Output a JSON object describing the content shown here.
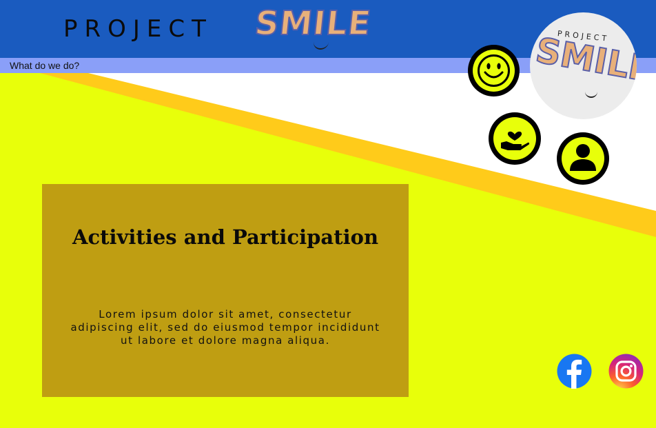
{
  "header": {
    "brand_word": "PROJECT",
    "logo_word": "SMILE"
  },
  "nav": {
    "link_label": "What do we do?"
  },
  "badge": {
    "small_text": "PROJECT",
    "logo_word": "SMILE"
  },
  "card": {
    "title": "Activities and Participation",
    "body": "Lorem ipsum dolor sit amet, consectetur adipiscing elit, sed do eiusmod tempor incididunt ut labore et dolore magna aliqua."
  },
  "icons": [
    "smiley-face-icon",
    "heart-in-hand-icon",
    "person-icon",
    "facebook-icon",
    "instagram-icon"
  ],
  "colors": {
    "header_blue": "#1a5bbf",
    "nav_strip": "#8a9ff8",
    "page_yellow": "#e8ff0a",
    "stripe_orange": "#ffcb1a",
    "card_gold": "#bf9e12"
  }
}
